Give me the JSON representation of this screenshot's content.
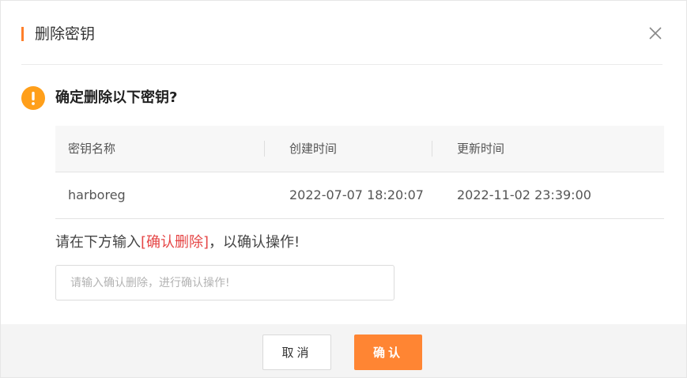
{
  "dialog": {
    "title": "删除密钥",
    "close_icon": "close-icon"
  },
  "warning": {
    "icon": "exclamation-circle-icon",
    "icon_color": "#ff9f1a",
    "question": "确定删除以下密钥?"
  },
  "table": {
    "headers": [
      "密钥名称",
      "创建时间",
      "更新时间"
    ],
    "rows": [
      [
        "harboreg",
        "2022-07-07 18:20:07",
        "2022-11-02 23:39:00"
      ]
    ]
  },
  "instruction": {
    "before": "请在下方输入",
    "highlight": "[确认删除]",
    "after": "，以确认操作!",
    "highlight_color": "#e54545"
  },
  "input": {
    "placeholder": "请输入确认删除，进行确认操作!",
    "value": ""
  },
  "footer": {
    "cancel_label": "取消",
    "confirm_label": "确认",
    "confirm_color": "#ff8533"
  },
  "colors": {
    "accent": "#ff7f2a"
  }
}
